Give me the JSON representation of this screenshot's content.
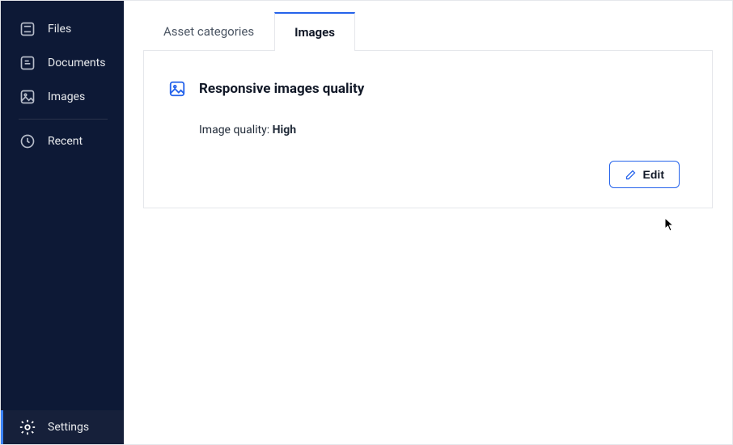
{
  "sidebar": {
    "items": [
      {
        "label": "Files"
      },
      {
        "label": "Documents"
      },
      {
        "label": "Images"
      },
      {
        "label": "Recent"
      }
    ],
    "settings_label": "Settings"
  },
  "tabs": [
    {
      "label": "Asset categories"
    },
    {
      "label": "Images"
    }
  ],
  "card": {
    "title": "Responsive images quality",
    "quality_label": "Image quality: ",
    "quality_value": "High",
    "edit_label": "Edit"
  }
}
